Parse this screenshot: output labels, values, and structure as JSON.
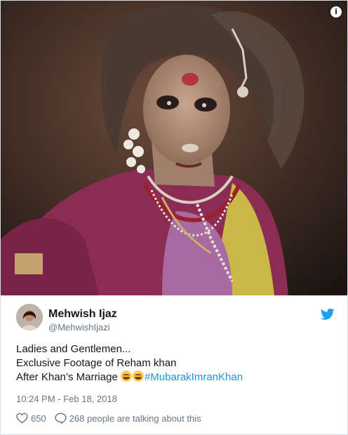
{
  "media": {
    "alt": "Photo",
    "info_icon": "info-circle-icon"
  },
  "author": {
    "display_name": "Mehwish Ijaz",
    "handle": "@MehwishIjazi",
    "avatar_icon": "avatar"
  },
  "brand": {
    "icon": "twitter-bird-icon",
    "color": "#1da1f2"
  },
  "tweet": {
    "lines": [
      "Ladies and Gentlemen...",
      "Exclusive Footage of Reham khan",
      "After Khan’s Marriage"
    ],
    "emoji": [
      "face-with-tears-of-joy",
      "face-with-tears-of-joy"
    ],
    "hashtag": "#MubarakImranKhan",
    "hashtag_color": "#1b95e0"
  },
  "meta": {
    "timestamp": "10:24 PM - Feb 18, 2018"
  },
  "actions": {
    "like_count": "650",
    "conversation_text": "268 people are talking about this",
    "like_icon": "heart-icon",
    "reply_icon": "speech-bubble-icon"
  }
}
